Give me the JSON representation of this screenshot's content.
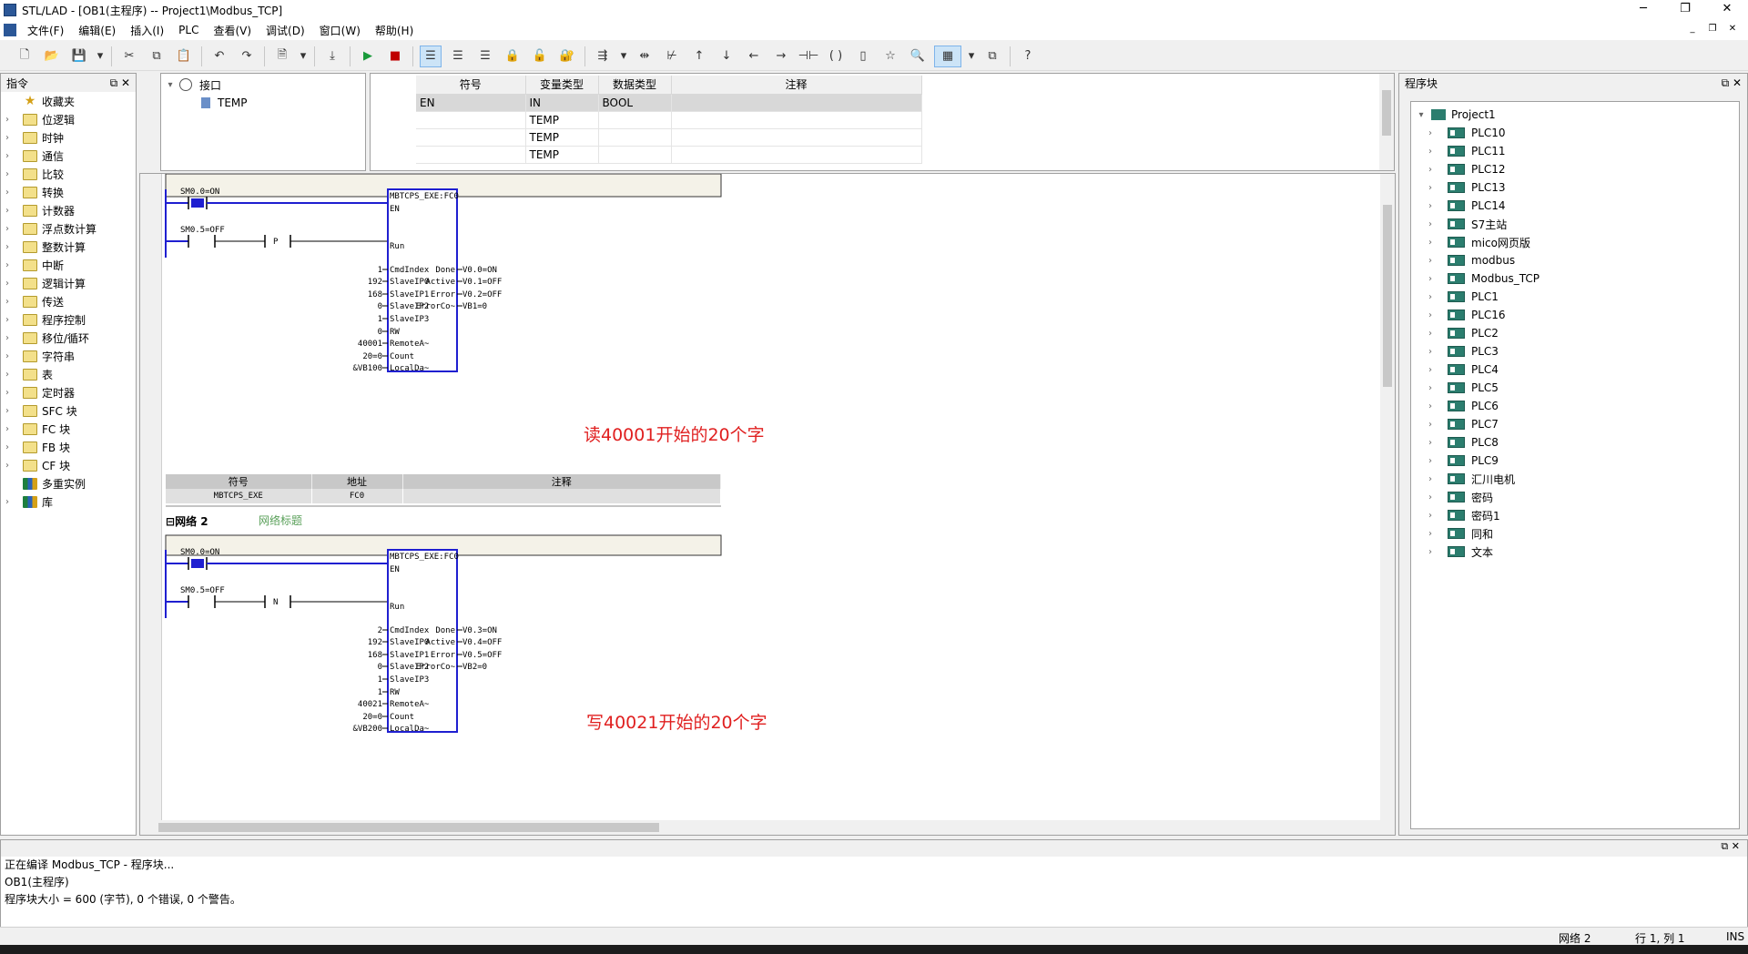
{
  "window": {
    "title": "STL/LAD - [OB1(主程序) -- Project1\\Modbus_TCP]"
  },
  "menu": [
    "文件(F)",
    "编辑(E)",
    "插入(I)",
    "PLC",
    "查看(V)",
    "调试(D)",
    "窗口(W)",
    "帮助(H)"
  ],
  "left_panel": {
    "title": "指令",
    "items": [
      {
        "label": "收藏夹",
        "icon": "star-icon"
      },
      {
        "label": "位逻辑",
        "icon": "folder-icon"
      },
      {
        "label": "时钟",
        "icon": "folder-icon"
      },
      {
        "label": "通信",
        "icon": "folder-icon"
      },
      {
        "label": "比较",
        "icon": "folder-icon"
      },
      {
        "label": "转换",
        "icon": "folder-icon"
      },
      {
        "label": "计数器",
        "icon": "folder-icon"
      },
      {
        "label": "浮点数计算",
        "icon": "folder-icon"
      },
      {
        "label": "整数计算",
        "icon": "folder-icon"
      },
      {
        "label": "中断",
        "icon": "folder-icon"
      },
      {
        "label": "逻辑计算",
        "icon": "folder-icon"
      },
      {
        "label": "传送",
        "icon": "folder-icon"
      },
      {
        "label": "程序控制",
        "icon": "folder-icon"
      },
      {
        "label": "移位/循环",
        "icon": "folder-icon"
      },
      {
        "label": "字符串",
        "icon": "folder-icon"
      },
      {
        "label": "表",
        "icon": "folder-icon"
      },
      {
        "label": "定时器",
        "icon": "folder-icon"
      },
      {
        "label": "SFC 块",
        "icon": "folder-icon"
      },
      {
        "label": "FC 块",
        "icon": "folder-icon"
      },
      {
        "label": "FB 块",
        "icon": "folder-icon"
      },
      {
        "label": "CF 块",
        "icon": "folder-icon"
      },
      {
        "label": "多重实例",
        "icon": "library-icon"
      },
      {
        "label": "库",
        "icon": "library-icon"
      }
    ]
  },
  "interface": {
    "root": "接口",
    "child": "TEMP"
  },
  "var_table": {
    "headers": [
      "符号",
      "变量类型",
      "数据类型",
      "注释"
    ],
    "rows": [
      [
        "EN",
        "IN",
        "BOOL",
        ""
      ],
      [
        "",
        "TEMP",
        "",
        ""
      ],
      [
        "",
        "TEMP",
        "",
        ""
      ],
      [
        "",
        "TEMP",
        "",
        ""
      ]
    ]
  },
  "network1": {
    "contact1": "SM0.0=ON",
    "contact2": "SM0.5=OFF",
    "edge": "P",
    "block_title": "MBTCPS_EXE:FC0",
    "pins_left": [
      "EN",
      "Run",
      "CmdIndex",
      "SlaveIP0",
      "SlaveIP1",
      "SlaveIP2",
      "SlaveIP3",
      "RW",
      "RemoteA~",
      "Count",
      "LocalDa~"
    ],
    "pins_right": [
      "Done",
      "Active",
      "Error",
      "ErrorCo~"
    ],
    "in_values": [
      "1",
      "192",
      "168",
      "0",
      "1",
      "0",
      "40001",
      "20=0",
      "&VB100"
    ],
    "out_values": [
      "V0.0=ON",
      "V0.1=OFF",
      "V0.2=OFF",
      "VB1=0"
    ],
    "comment": "读40001开始的20个字"
  },
  "symbol_table": {
    "headers": [
      "符号",
      "地址",
      "注释"
    ],
    "row": [
      "MBTCPS_EXE",
      "FC0",
      ""
    ]
  },
  "network2": {
    "label": "网络 2",
    "title_hint": "网络标题",
    "contact1": "SM0.0=ON",
    "contact2": "SM0.5=OFF",
    "edge": "N",
    "block_title": "MBTCPS_EXE:FC0",
    "pins_left": [
      "EN",
      "Run",
      "CmdIndex",
      "SlaveIP0",
      "SlaveIP1",
      "SlaveIP2",
      "SlaveIP3",
      "RW",
      "RemoteA~",
      "Count",
      "LocalDa~"
    ],
    "pins_right": [
      "Done",
      "Active",
      "Error",
      "ErrorCo~"
    ],
    "in_values": [
      "2",
      "192",
      "168",
      "0",
      "1",
      "1",
      "40021",
      "20=0",
      "&VB200"
    ],
    "out_values": [
      "V0.3=ON",
      "V0.4=OFF",
      "V0.5=OFF",
      "VB2=0"
    ],
    "comment": "写40021开始的20个字"
  },
  "right_panel": {
    "title": "程序块",
    "root": "Project1",
    "items": [
      "PLC10",
      "PLC11",
      "PLC12",
      "PLC13",
      "PLC14",
      "S7主站",
      "mico网页版",
      "modbus",
      "Modbus_TCP",
      "PLC1",
      "PLC16",
      "PLC2",
      "PLC3",
      "PLC4",
      "PLC5",
      "PLC6",
      "PLC7",
      "PLC8",
      "PLC9",
      "汇川电机",
      "密码",
      "密码1",
      "同和",
      "文本"
    ]
  },
  "output": {
    "lines": [
      "正在编译 Modbus_TCP - 程序块...",
      "OB1(主程序)",
      "程序块大小 = 600 (字节), 0 个错误, 0 个警告。"
    ]
  },
  "status": {
    "network": "网络 2",
    "position": "行 1, 列 1",
    "mode": "INS"
  }
}
